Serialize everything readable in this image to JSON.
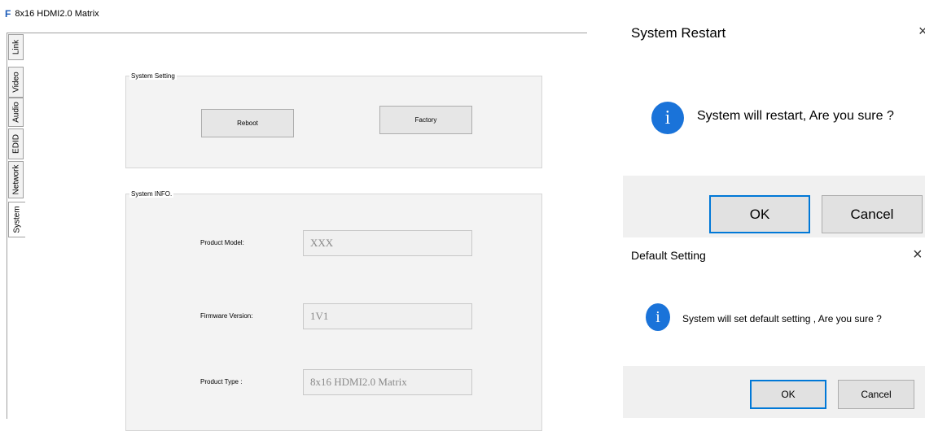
{
  "app": {
    "icon": "F",
    "title": "8x16 HDMI2.0 Matrix"
  },
  "tabs": [
    {
      "label": "Link"
    },
    {
      "label": "Video"
    },
    {
      "label": "Audio"
    },
    {
      "label": "EDID"
    },
    {
      "label": "Network"
    },
    {
      "label": "System",
      "active": true
    }
  ],
  "system_setting": {
    "label": "System Setting",
    "reboot": "Reboot",
    "factory": "Factory"
  },
  "system_info": {
    "label": "System INFO.",
    "product_model_label": "Product Model:",
    "product_model_value": "XXX",
    "firmware_label": "Firmware Version:",
    "firmware_value": "1V1",
    "product_type_label": "Product Type :",
    "product_type_value": "8x16 HDMI2.0 Matrix"
  },
  "restart_dialog": {
    "title": "System Restart",
    "icon": "info-icon",
    "message": "System will restart, Are you sure ?",
    "ok": "OK",
    "cancel": "Cancel"
  },
  "default_dialog": {
    "title": "Default Setting",
    "close": "×",
    "icon": "info-icon",
    "message": "System will set default setting , Are you sure ?",
    "ok": "OK",
    "cancel": "Cancel"
  },
  "colors": {
    "accent": "#0078d7",
    "info_icon": "#1a73d9"
  }
}
